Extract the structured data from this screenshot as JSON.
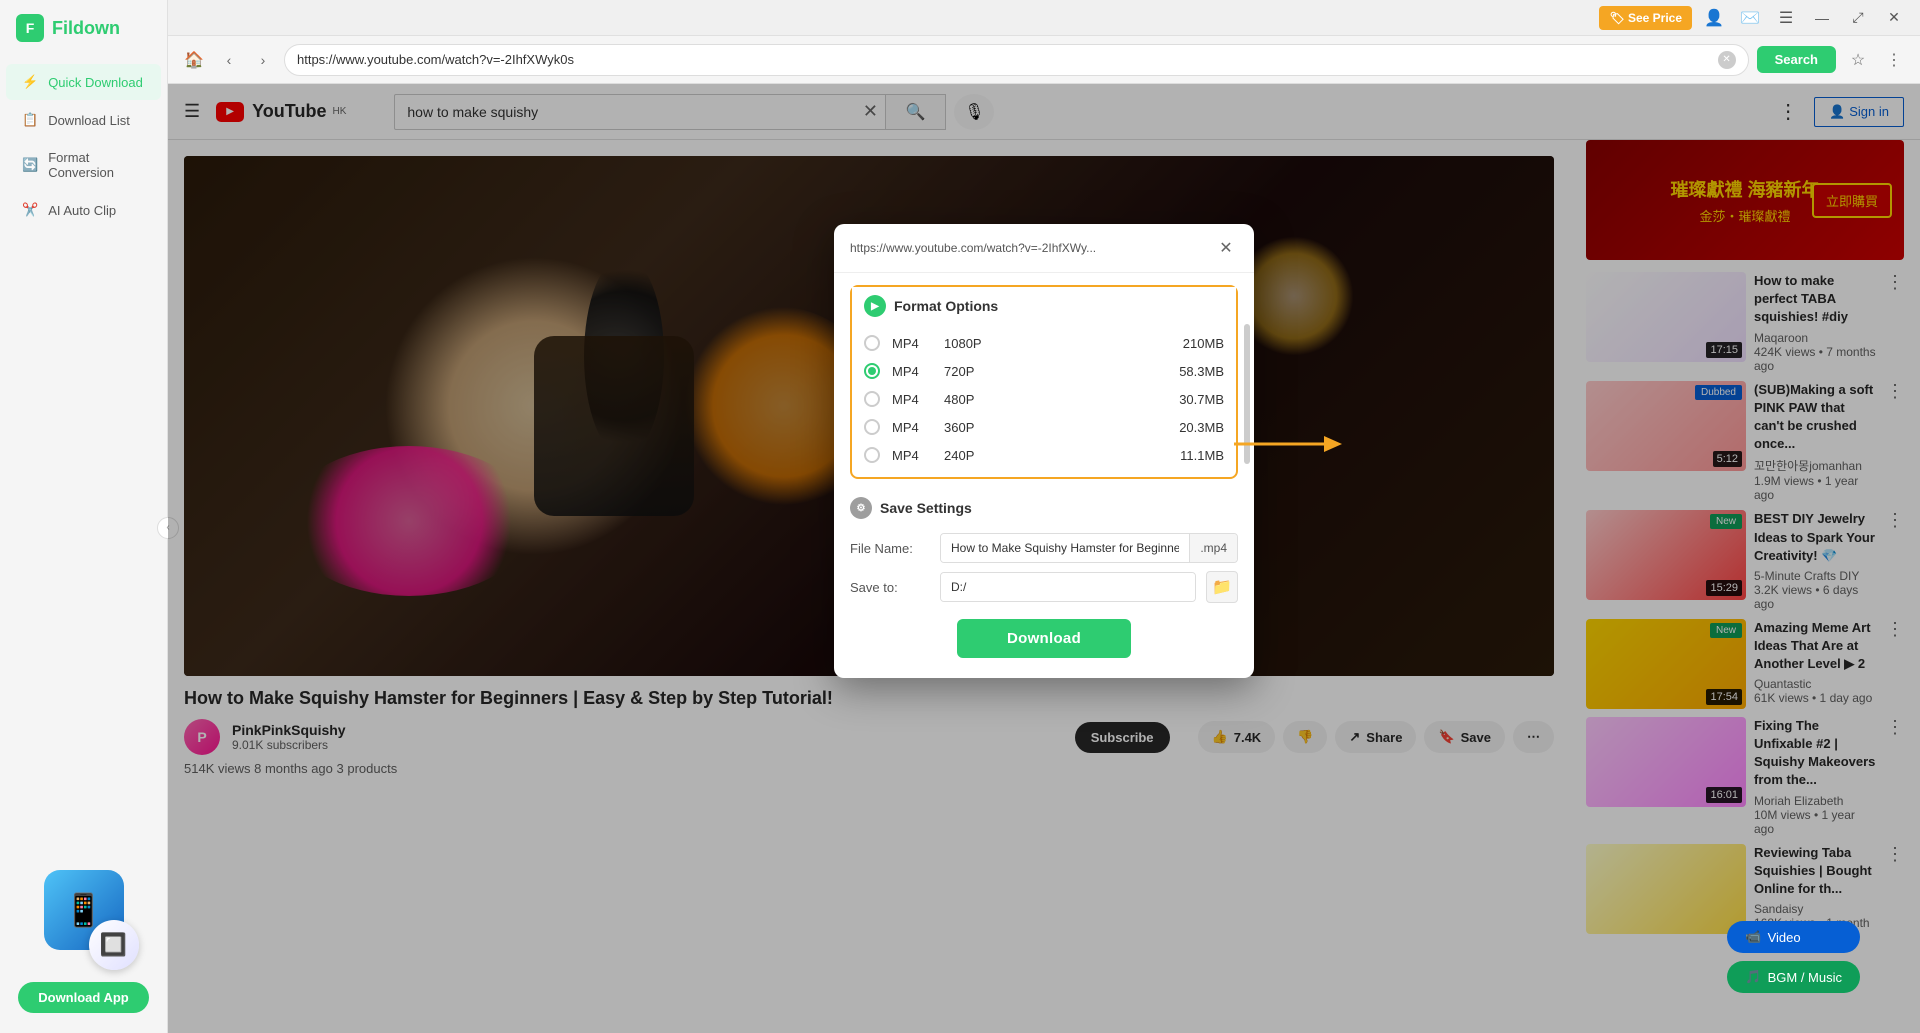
{
  "app": {
    "title": "Fildown",
    "see_price_label": "🏷 See Price",
    "window_controls": {
      "minimize": "–",
      "resize": "⤢",
      "close": "✕"
    }
  },
  "sidebar": {
    "logo_text": "Fildown",
    "nav_items": [
      {
        "id": "quick-download",
        "label": "Quick Download",
        "icon": "⚡",
        "active": true
      },
      {
        "id": "download-list",
        "label": "Download List",
        "icon": "📋"
      },
      {
        "id": "format-conversion",
        "label": "Format Conversion",
        "icon": "🔄"
      },
      {
        "id": "ai-auto-clip",
        "label": "AI Auto Clip",
        "icon": "✂️"
      }
    ],
    "download_app_label": "Download App"
  },
  "browser": {
    "url": "https://www.youtube.com/watch?v=-2IhfXWyk0s",
    "search_label": "Search"
  },
  "youtube": {
    "search_query": "how to make squishy",
    "logo_region": "HK",
    "sign_in_label": "Sign in",
    "video_title": "How to Make Squishy Hamster for Beginners | Easy & Step by Step Tutorial!",
    "channel_name": "PinkPinkSquishy",
    "channel_subs": "9.01K subscribers",
    "subscribe_label": "Subscribe",
    "likes": "7.4K",
    "share_label": "Share",
    "save_label": "Save",
    "views": "514K views",
    "upload_date": "8 months ago",
    "products": "3 products",
    "related_videos": [
      {
        "title": "How to make perfect TABA squishies! #diy",
        "channel": "Maqaroon",
        "views": "424K views",
        "ago": "7 months ago",
        "duration": "17:15",
        "badge": "",
        "thumb_class": "thumb-taba"
      },
      {
        "title": "(SUB)Making a soft PINK PAW that can't be crushed once...",
        "channel": "꼬만한아몽jomanhan",
        "views": "1.9M views",
        "ago": "1 year ago",
        "duration": "5:12",
        "badge": "Dubbed",
        "thumb_class": "thumb-paw"
      },
      {
        "title": "BEST DIY Jewelry Ideas to Spark Your Creativity! 💎",
        "channel": "5-Minute Crafts DIY",
        "views": "3.2K views",
        "ago": "6 days ago",
        "duration": "15:29",
        "badge": "New",
        "thumb_class": "thumb-jewelry"
      },
      {
        "title": "Amazing Meme Art Ideas That Are at Another Level ▶ 2",
        "channel": "Quantastic",
        "views": "61K views",
        "ago": "1 day ago",
        "duration": "17:54",
        "badge": "New",
        "thumb_class": "thumb-meme"
      },
      {
        "title": "Fixing The Unfixable #2 | Squishy Makeovers from the...",
        "channel": "Moriah Elizabeth",
        "views": "10M views",
        "ago": "1 year ago",
        "duration": "16:01",
        "badge": "",
        "thumb_class": "thumb-unfixable"
      },
      {
        "title": "Reviewing Taba Squishies | Bought Online for th...",
        "channel": "Sandaisy",
        "views": "168K views",
        "ago": "1 month",
        "duration": "",
        "badge": "",
        "thumb_class": "thumb-reviewing"
      }
    ]
  },
  "download_dialog": {
    "url_display": "https://www.youtube.com/watch?v=-2IhfXWy...",
    "format_options_label": "Format Options",
    "formats": [
      {
        "codec": "MP4",
        "resolution": "1080P",
        "size": "210MB",
        "selected": false
      },
      {
        "codec": "MP4",
        "resolution": "720P",
        "size": "58.3MB",
        "selected": true
      },
      {
        "codec": "MP4",
        "resolution": "480P",
        "size": "30.7MB",
        "selected": false
      },
      {
        "codec": "MP4",
        "resolution": "360P",
        "size": "20.3MB",
        "selected": false
      },
      {
        "codec": "MP4",
        "resolution": "240P",
        "size": "11.1MB",
        "selected": false
      }
    ],
    "save_settings_label": "Save Settings",
    "file_name_label": "File Name:",
    "file_name_value": "How to Make Squishy Hamster for Beginners  Easy &",
    "file_ext": ".mp4",
    "save_to_label": "Save to:",
    "save_to_value": "D:/",
    "download_btn_label": "Download"
  },
  "floating_badges": {
    "video_label": "Video",
    "bgm_label": "BGM / Music"
  }
}
